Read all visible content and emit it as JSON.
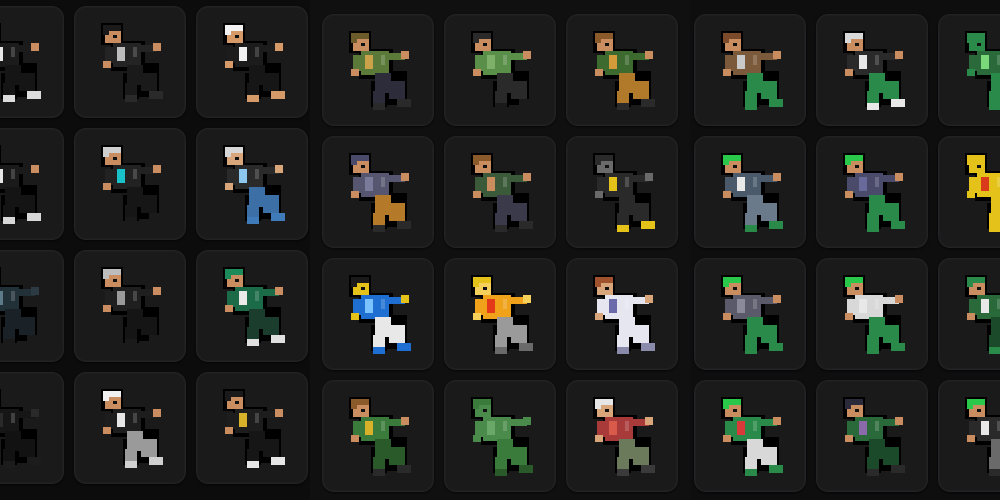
{
  "palette": {
    "background": "#0b0b0c",
    "tile": "#1a1a1b",
    "tile_border": "#232325"
  },
  "panels": [
    {
      "name": "outfit-panel-left",
      "tiles": [
        {
          "name": "black-suit-character",
          "hair": "#222222",
          "top": "#1b1b1b",
          "pants": "#151515",
          "accent": "#e8e8e8",
          "skin": "#c98d5f",
          "shoes": "#dddddd"
        },
        {
          "name": "black-leather-character",
          "hair": "#1a1a1a",
          "top": "#242424",
          "pants": "#1a1a1a",
          "accent": "#bdbdbd",
          "skin": "#c98d5f",
          "shoes": "#2a2a2a"
        },
        {
          "name": "white-hat-black-suit-character",
          "hair": "#f2f2f2",
          "top": "#1c1c1c",
          "pants": "#161616",
          "accent": "#f2f2f2",
          "skin": "#d59a67",
          "shoes": "#d59a67"
        },
        {
          "name": "black-shield-character",
          "hair": "#1b1b1b",
          "top": "#1a1a1a",
          "pants": "#141414",
          "accent": "#e6e6e6",
          "skin": "#c98d5f",
          "shoes": "#d8d8d8"
        },
        {
          "name": "goggles-black-character",
          "hair": "#cfcfcf",
          "top": "#222222",
          "pants": "#161616",
          "accent": "#19c2c9",
          "skin": "#c98d5f",
          "shoes": "#1a1a1a"
        },
        {
          "name": "silver-hair-blue-character",
          "hair": "#d7d7d7",
          "top": "#2a2a2a",
          "pants": "#3b6fa6",
          "accent": "#8cc7ee",
          "skin": "#d9a57a",
          "shoes": "#3f7bb8"
        },
        {
          "name": "dark-armor-character",
          "hair": "#2c3a44",
          "top": "#223038",
          "pants": "#1a2228",
          "accent": "#5d7a88",
          "skin": "#2c3a44",
          "shoes": "#1a1a1a"
        },
        {
          "name": "gray-hair-black-character",
          "hair": "#bdbdbd",
          "top": "#1f1f1f",
          "pants": "#151515",
          "accent": "#9a9a9a",
          "skin": "#c98d5f",
          "shoes": "#1a1a1a"
        },
        {
          "name": "teal-hood-character",
          "hair": "#1d8a5a",
          "top": "#1b6b48",
          "pants": "#1a3d2d",
          "accent": "#eaeaea",
          "skin": "#c98d5f",
          "shoes": "#e0e0e0"
        },
        {
          "name": "shadow-character",
          "hair": "#1a1a1a",
          "top": "#161616",
          "pants": "#121212",
          "accent": "#2a2a2a",
          "skin": "#2a2a2a",
          "shoes": "#1c1c1c"
        },
        {
          "name": "white-cap-black-character",
          "hair": "#f0f0f0",
          "top": "#1d1d1d",
          "pants": "#9a9a9a",
          "accent": "#e6e6e6",
          "skin": "#c98d5f",
          "shoes": "#d0d0d0"
        },
        {
          "name": "gold-trim-black-character",
          "hair": "#1a1a1a",
          "top": "#1d1d1d",
          "pants": "#161616",
          "accent": "#d8b12a",
          "skin": "#c98d5f",
          "shoes": "#e6e6e6"
        }
      ]
    },
    {
      "name": "outfit-panel-middle",
      "tiles": [
        {
          "name": "olive-hood-character",
          "hair": "#6b5a2a",
          "top": "#5b7a3a",
          "pants": "#2c2c3a",
          "accent": "#c9a24a",
          "skin": "#c98d5f",
          "shoes": "#2a2a2a"
        },
        {
          "name": "green-shirt-character",
          "hair": "#2a2a2a",
          "top": "#5a8f4a",
          "pants": "#2a2a2a",
          "accent": "#7fb06a",
          "skin": "#c98d5f",
          "shoes": "#1a1a1a"
        },
        {
          "name": "brown-spiky-character",
          "hair": "#8a5a2a",
          "top": "#3d6a2f",
          "pants": "#b07a2a",
          "accent": "#d59a3a",
          "skin": "#c98d5f",
          "shoes": "#2a2a2a"
        },
        {
          "name": "purple-hood-character",
          "hair": "#4a4a6a",
          "top": "#565670",
          "pants": "#b47a2a",
          "accent": "#7a7a9a",
          "skin": "#c98d5f",
          "shoes": "#2a2a2a"
        },
        {
          "name": "brown-hair-vest-character",
          "hair": "#8a5a2a",
          "top": "#3a5a3a",
          "pants": "#3a3a4a",
          "accent": "#c98d5f",
          "skin": "#c98d5f",
          "shoes": "#2a2a2a"
        },
        {
          "name": "lightning-suit-character",
          "hair": "#2a2a2a",
          "top": "#2a2a2a",
          "pants": "#2a2a2a",
          "accent": "#e5c21a",
          "skin": "#6a6a6a",
          "shoes": "#e5c21a"
        },
        {
          "name": "blue-armor-character",
          "hair": "#1a1a1a",
          "top": "#1e6fd1",
          "pants": "#e8e8e8",
          "accent": "#7ac3ff",
          "skin": "#e5c21a",
          "shoes": "#1e6fd1"
        },
        {
          "name": "yellow-fire-character",
          "hair": "#e5c21a",
          "top": "#f0a21a",
          "pants": "#9a9a9a",
          "accent": "#e53a1a",
          "skin": "#f5d05a",
          "shoes": "#6a6a6a"
        },
        {
          "name": "white-robe-character",
          "hair": "#a0522d",
          "top": "#e6e6f0",
          "pants": "#e6e6f0",
          "accent": "#6a6aaa",
          "skin": "#d9a57a",
          "shoes": "#8a8aaa"
        },
        {
          "name": "winged-green-character",
          "hair": "#8a5a2a",
          "top": "#3a7a3a",
          "pants": "#2a5a2a",
          "accent": "#d8b12a",
          "skin": "#c98d5f",
          "shoes": "#2a2a2a"
        },
        {
          "name": "mummy-character",
          "hair": "#3a7a3a",
          "top": "#4a8a4a",
          "pants": "#3a7a3a",
          "accent": "#6aa86a",
          "skin": "#4a8a4a",
          "shoes": "#2a5a2a"
        },
        {
          "name": "red-bandana-character",
          "hair": "#e6e6e6",
          "top": "#a83a3a",
          "pants": "#6a7a5a",
          "accent": "#d85a4a",
          "skin": "#d9a57a",
          "shoes": "#3a3a3a"
        }
      ]
    },
    {
      "name": "outfit-panel-right",
      "tiles": [
        {
          "name": "brown-hat-archer-character",
          "hair": "#7a4a2a",
          "top": "#7a5a3a",
          "pants": "#2a8a4a",
          "accent": "#c9c9c9",
          "skin": "#c98d5f",
          "shoes": "#2a8a4a"
        },
        {
          "name": "white-hair-green-character",
          "hair": "#d8d8d8",
          "top": "#2a2a2a",
          "pants": "#2a8a4a",
          "accent": "#e8e8e8",
          "skin": "#c98d5f",
          "shoes": "#e8e8e8"
        },
        {
          "name": "green-horns-character",
          "hair": "#2a8a4a",
          "top": "#2a6a3a",
          "pants": "#2a8a4a",
          "accent": "#7ad87a",
          "skin": "#2a8a4a",
          "shoes": "#2a8a4a"
        },
        {
          "name": "bunny-ears-character",
          "hair": "#2ac84a",
          "top": "#4a5a6a",
          "pants": "#6a7a8a",
          "accent": "#e8e8e8",
          "skin": "#c98d5f",
          "shoes": "#2a8a4a"
        },
        {
          "name": "green-hair-purple-character",
          "hair": "#2ac84a",
          "top": "#4a4a6a",
          "pants": "#2a8a4a",
          "accent": "#6a6a9a",
          "skin": "#c98d5f",
          "shoes": "#2a8a4a"
        },
        {
          "name": "yellow-pikachu-character",
          "hair": "#e5c21a",
          "top": "#e5c21a",
          "pants": "#e5c21a",
          "accent": "#d83a1a",
          "skin": "#e5c21a",
          "shoes": "#e5c21a"
        },
        {
          "name": "green-hair-gray-character",
          "hair": "#2ac84a",
          "top": "#5a5a6a",
          "pants": "#2a8a4a",
          "accent": "#8a8a9a",
          "skin": "#c98d5f",
          "shoes": "#2a8a4a"
        },
        {
          "name": "green-hair-white-character",
          "hair": "#2ac84a",
          "top": "#d8d8d8",
          "pants": "#2a8a4a",
          "accent": "#e8e8e8",
          "skin": "#c98d5f",
          "shoes": "#2a8a4a"
        },
        {
          "name": "green-sword-character",
          "hair": "#2a8a4a",
          "top": "#2a6a3a",
          "pants": "#1a4a2a",
          "accent": "#e8e8e8",
          "skin": "#c98d5f",
          "shoes": "#2a8a4a"
        },
        {
          "name": "green-red-robe-character",
          "hair": "#2ac84a",
          "top": "#2a8a4a",
          "pants": "#d8d8d8",
          "accent": "#d83a3a",
          "skin": "#c98d5f",
          "shoes": "#2a8a4a"
        },
        {
          "name": "witch-hat-character",
          "hair": "#2a2a3a",
          "top": "#2a6a3a",
          "pants": "#1a4a2a",
          "accent": "#8a6aaa",
          "skin": "#c98d5f",
          "shoes": "#2a2a2a"
        },
        {
          "name": "green-hair-black-character",
          "hair": "#2ac84a",
          "top": "#2a2a2a",
          "pants": "#6a6a6a",
          "accent": "#e8e8e8",
          "skin": "#c98d5f",
          "shoes": "#2a2a2a"
        }
      ]
    }
  ]
}
